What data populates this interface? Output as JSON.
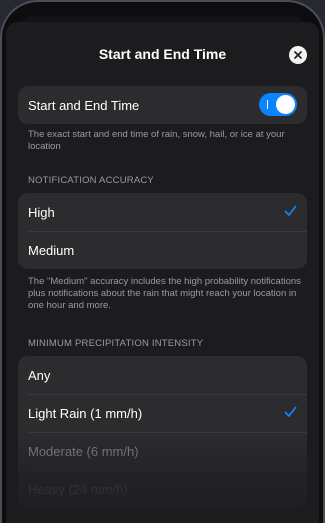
{
  "sheet": {
    "title": "Start and End Time"
  },
  "toggle_row": {
    "label": "Start and End Time",
    "enabled": true,
    "description": "The exact start and end time of rain, snow, hail, or ice at your location"
  },
  "notification_accuracy": {
    "header": "NOTIFICATION ACCURACY",
    "options": [
      {
        "label": "High",
        "selected": true
      },
      {
        "label": "Medium",
        "selected": false
      }
    ],
    "note": "The \"Medium\" accuracy includes the high probability notifications plus notifications about the rain that might reach your location in one hour and more."
  },
  "minimum_precipitation": {
    "header": "MINIMUM PRECIPITATION INTENSITY",
    "options": [
      {
        "label": "Any",
        "selected": false
      },
      {
        "label": "Light Rain (1 mm/h)",
        "selected": true
      },
      {
        "label": "Moderate (6 mm/h)",
        "selected": false
      },
      {
        "label": "Heavy (24 mm/h)",
        "selected": false
      }
    ]
  },
  "colors": {
    "accent": "#0a84ff",
    "sheet_background": "#1c1c1e",
    "card_background": "#2c2c2e",
    "secondary_text": "#9a9aa0"
  }
}
